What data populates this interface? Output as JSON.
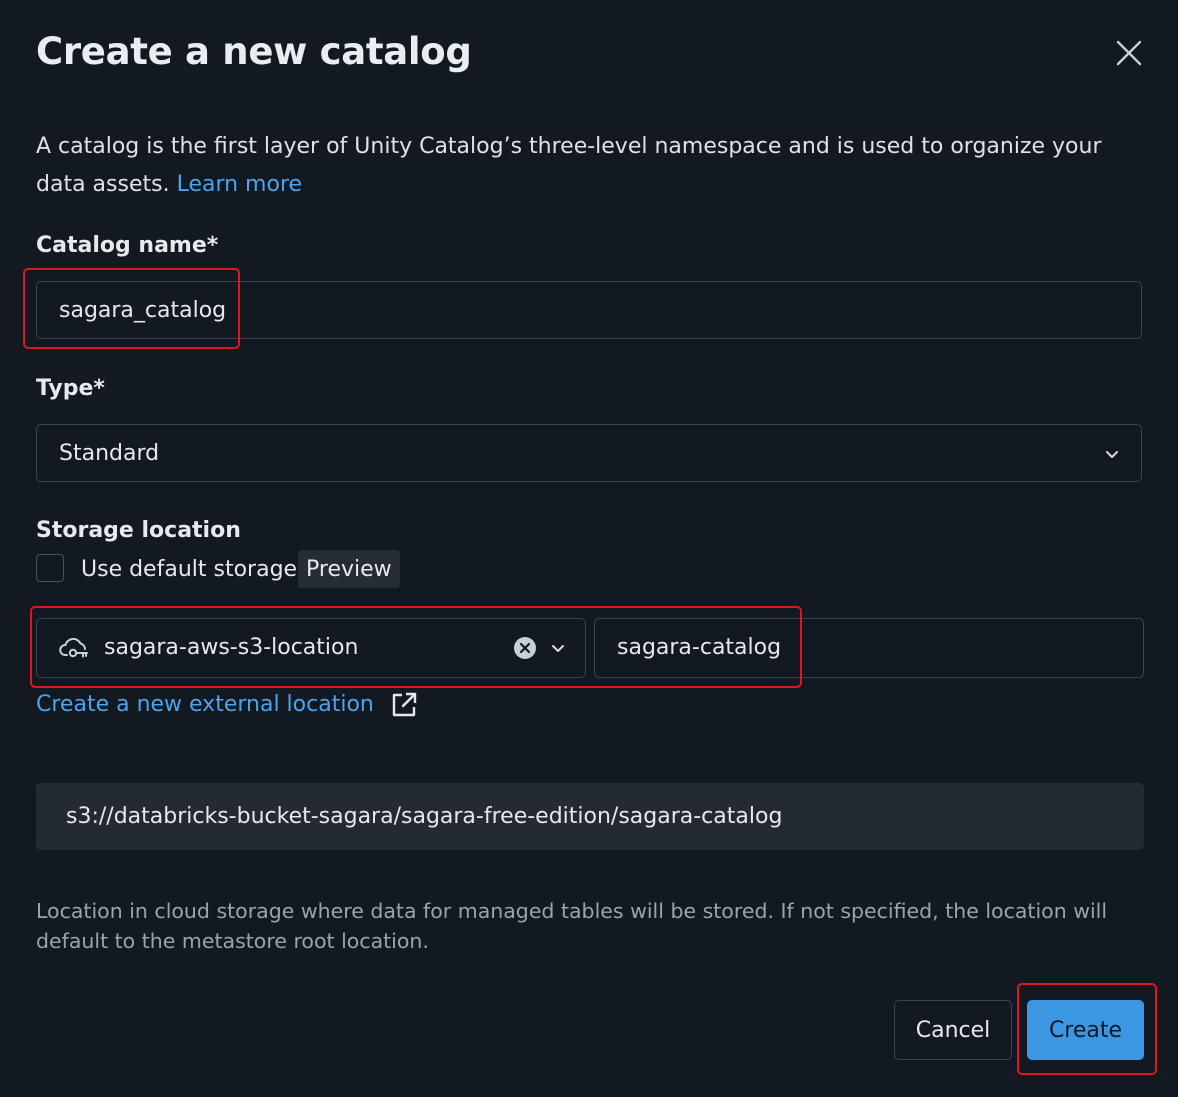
{
  "dialog": {
    "title": "Create a new catalog",
    "close_icon": "close-icon",
    "description": "A catalog is the first layer of Unity Catalog’s three-level namespace and is used to organize your data assets.",
    "learn_more": "Learn more"
  },
  "form": {
    "catalog_name": {
      "label": "Catalog name*",
      "value": "sagara_catalog"
    },
    "type": {
      "label": "Type*",
      "selected": "Standard",
      "icon": "chevron-down-icon"
    },
    "storage": {
      "label": "Storage location",
      "default_storage_label": "Use default storage",
      "default_storage_checked": false,
      "preview_badge": "Preview",
      "external_location": {
        "selected": "sagara-aws-s3-location",
        "icon": "cloud-key-icon"
      },
      "sub_path": "sagara-catalog",
      "create_external_link": "Create a new external location",
      "resolved_path": "s3://databricks-bucket-sagara/sagara-free-edition/sagara-catalog",
      "help_text": "Location in cloud storage where data for managed tables will be stored. If not specified, the location will default to the metastore root location."
    }
  },
  "actions": {
    "cancel": "Cancel",
    "create": "Create"
  },
  "colors": {
    "background": "#131920",
    "accent": "#3b97e1",
    "link": "#4ba3ee",
    "highlight_annotation": "#e0161f"
  }
}
